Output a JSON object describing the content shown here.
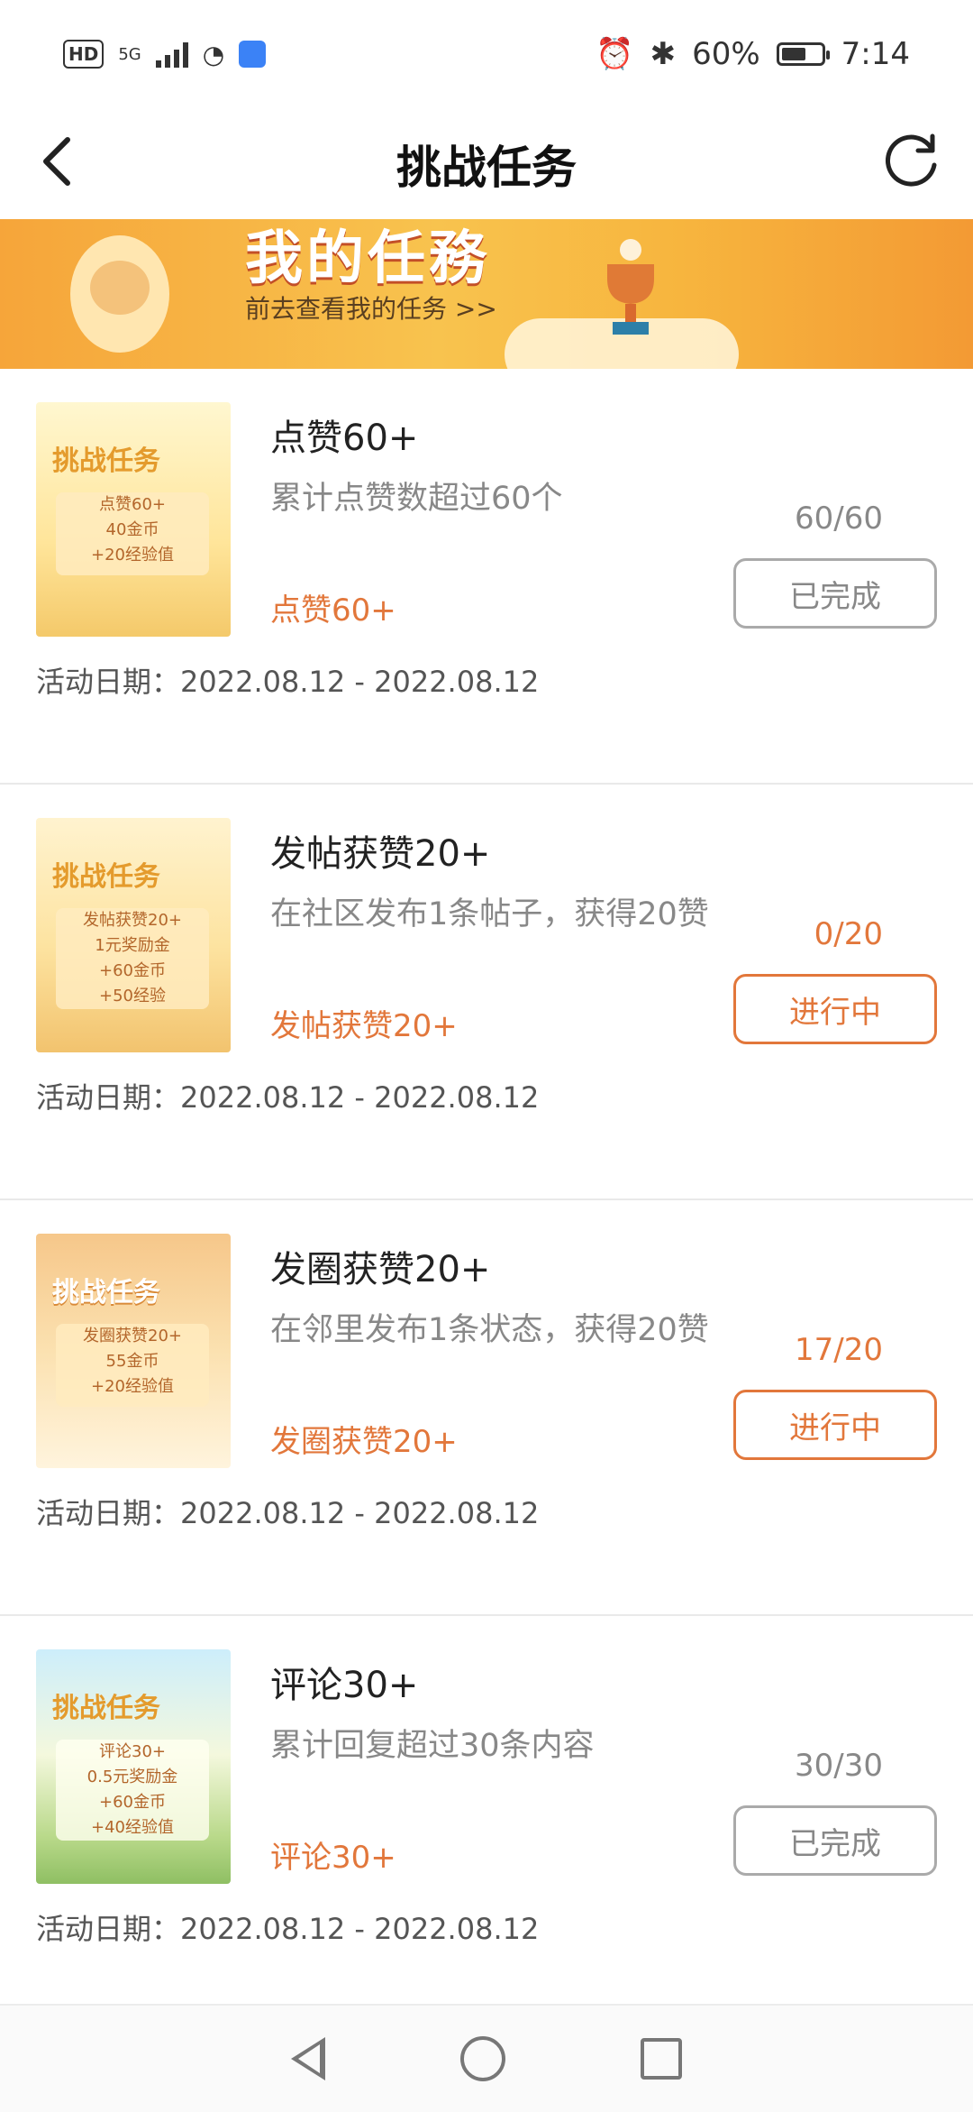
{
  "status_bar": {
    "left": {
      "hd": "HD",
      "network": "5G"
    },
    "right": {
      "battery_percent": "60%",
      "time": "7:14",
      "battery_level": 0.6
    }
  },
  "nav": {
    "title": "挑战任务",
    "back_icon": "back-arrow-icon",
    "refresh_icon": "refresh-icon"
  },
  "banner": {
    "title": "我的任務",
    "subtitle": "前去查看我的任务 >>"
  },
  "tasks": [
    {
      "name": "点赞60+",
      "desc": "累计点赞数超过60个",
      "tag": "点赞60+",
      "progress": "60/60",
      "status": "已完成",
      "active": false,
      "date": "活动日期：2022.08.12 - 2022.08.12",
      "thumb": {
        "title": "挑战任务",
        "lines": [
          "点赞60+",
          "40金币",
          "+20经验值"
        ]
      }
    },
    {
      "name": "发帖获赞20+",
      "desc": "在社区发布1条帖子，获得20赞",
      "tag": "发帖获赞20+",
      "progress": "0/20",
      "status": "进行中",
      "active": true,
      "date": "活动日期：2022.08.12 - 2022.08.12",
      "thumb": {
        "title": "挑战任务",
        "lines": [
          "发帖获赞20+",
          "1元奖励金",
          "+60金币",
          "+50经验"
        ]
      }
    },
    {
      "name": "发圈获赞20+",
      "desc": "在邻里发布1条状态，获得20赞",
      "tag": "发圈获赞20+",
      "progress": "17/20",
      "status": "进行中",
      "active": true,
      "date": "活动日期：2022.08.12 - 2022.08.12",
      "thumb": {
        "title": "挑战任务",
        "lines": [
          "发圈获赞20+",
          "55金币",
          "+20经验值"
        ]
      }
    },
    {
      "name": "评论30+",
      "desc": "累计回复超过30条内容",
      "tag": "评论30+",
      "progress": "30/30",
      "status": "已完成",
      "active": false,
      "date": "活动日期：2022.08.12 - 2022.08.12",
      "thumb": {
        "title": "挑战任务",
        "lines": [
          "评论30+",
          "0.5元奖励金",
          "+60金币",
          "+40经验值"
        ]
      }
    }
  ],
  "colors": {
    "accent": "#e2773b",
    "muted": "#888888"
  }
}
